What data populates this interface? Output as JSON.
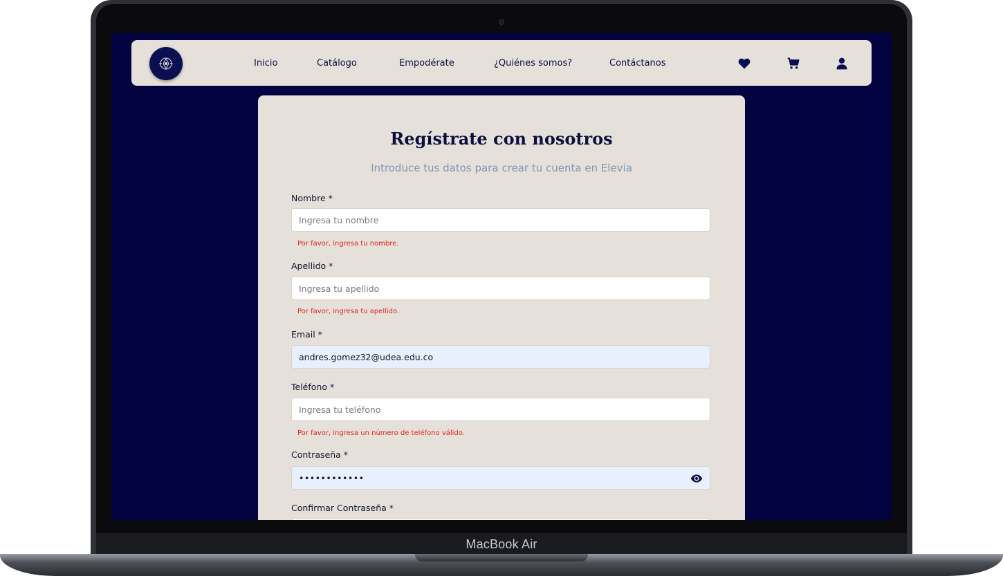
{
  "device": {
    "label": "MacBook Air"
  },
  "nav": {
    "links": [
      "Inicio",
      "Catálogo",
      "Empodérate",
      "¿Quiénes somos?",
      "Contáctanos"
    ]
  },
  "form": {
    "title": "Regístrate con nosotros",
    "subtitle": "Introduce tus datos para crear tu cuenta en Elevia",
    "nombre": {
      "label": "Nombre *",
      "placeholder": "Ingresa tu nombre",
      "value": "",
      "error": "Por favor, ingresa tu nombre."
    },
    "apellido": {
      "label": "Apellido *",
      "placeholder": "Ingresa tu apellido",
      "value": "",
      "error": "Por favor, ingresa tu apellido."
    },
    "email": {
      "label": "Email *",
      "value": "andres.gomez32@udea.edu.co"
    },
    "telefono": {
      "label": "Teléfono *",
      "placeholder": "Ingresa tu teléfono",
      "value": "",
      "error": "Por favor, ingresa un número de teléfono válido."
    },
    "contrasena": {
      "label": "Contraseña *",
      "value": "••••••••••••"
    },
    "confirmar": {
      "label": "Confirmar Contraseña *"
    }
  },
  "colors": {
    "background": "#020240",
    "surface": "#e6e0da",
    "primary": "#0a0f52",
    "error": "#e0241f",
    "subtitle": "#7f97b8",
    "autofill": "#e8f0fe"
  },
  "icons": [
    "logo-icon",
    "heart-icon",
    "cart-icon",
    "user-icon",
    "eye-icon"
  ]
}
